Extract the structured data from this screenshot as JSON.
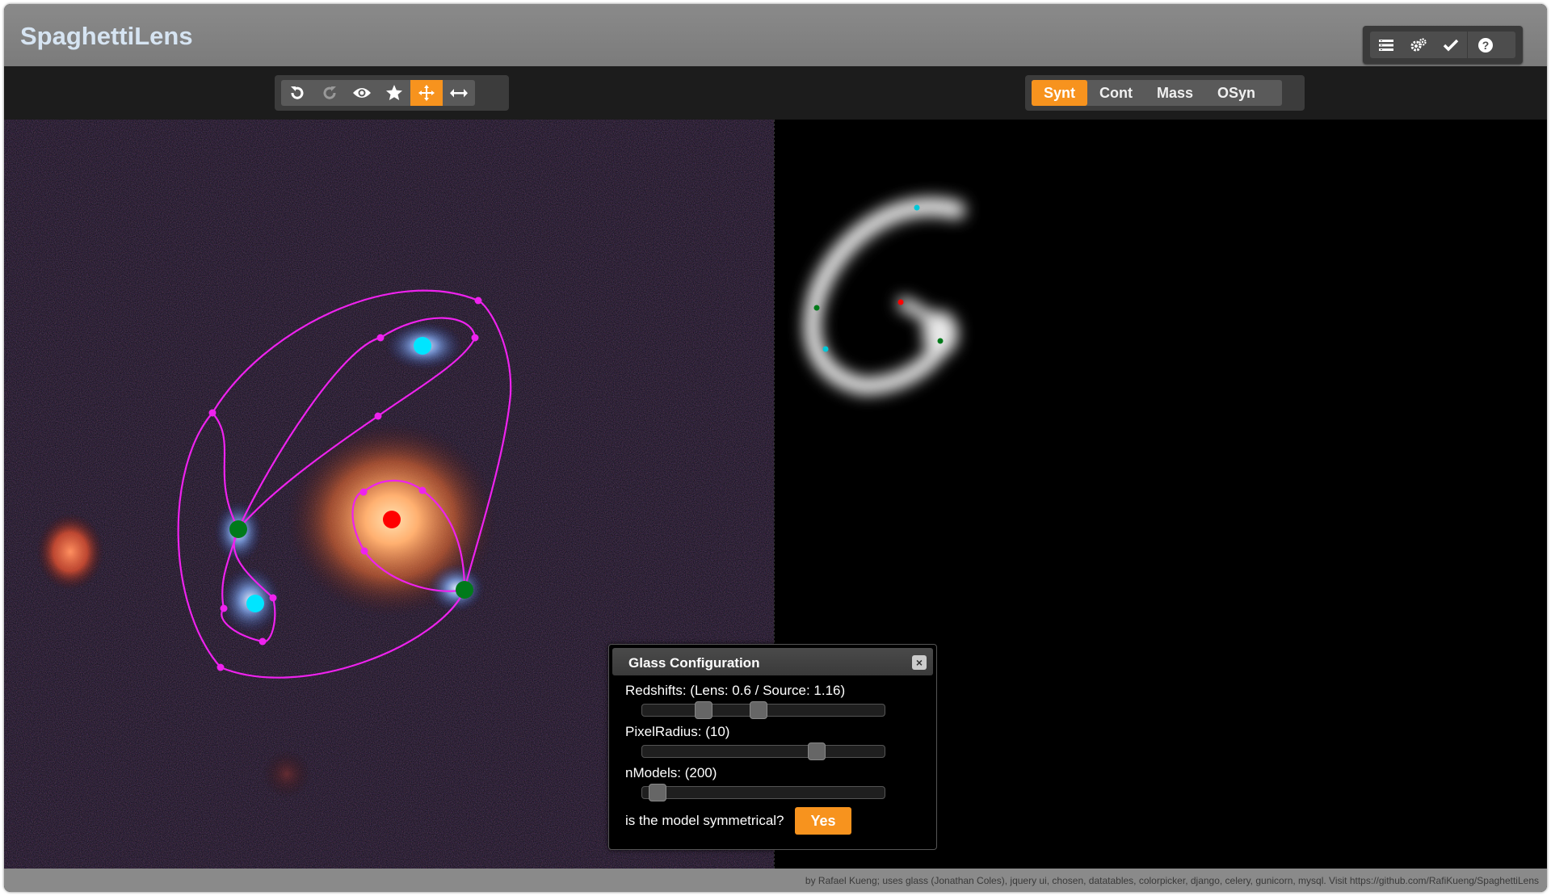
{
  "app": {
    "title": "SpaghettiLens"
  },
  "top_right_buttons": [
    {
      "icon": "list-icon"
    },
    {
      "icon": "gears-icon"
    },
    {
      "icon": "check-icon"
    },
    {
      "icon": "help-icon"
    }
  ],
  "toolbar": {
    "tools": [
      {
        "icon": "undo-icon",
        "state": "enabled"
      },
      {
        "icon": "redo-icon",
        "state": "disabled"
      },
      {
        "icon": "eye-icon",
        "state": "enabled"
      },
      {
        "icon": "star-icon",
        "state": "enabled"
      },
      {
        "icon": "move-icon",
        "state": "active"
      },
      {
        "icon": "resize-horizontal-icon",
        "state": "enabled"
      }
    ],
    "modes": [
      {
        "label": "Synt",
        "active": true
      },
      {
        "label": "Cont",
        "active": false
      },
      {
        "label": "Mass",
        "active": false
      },
      {
        "label": "OSyn",
        "active": false
      }
    ]
  },
  "dialog": {
    "title": "Glass Configuration",
    "close_label": "×",
    "redshifts_label": "Redshifts: (Lens: 0.6 / Source: 1.16)",
    "pixelradius_label": "PixelRadius: (10)",
    "nmodels_label": "nModels: (200)",
    "symmetric_question": "is the model symmetrical?",
    "symmetric_button": "Yes",
    "values": {
      "lens_redshift": 0.6,
      "source_redshift": 1.16,
      "pixel_radius": 10,
      "n_models": 200
    }
  },
  "colors": {
    "accent": "#f7931e",
    "contour": "#ee22ee",
    "saddle_point": "#007a1a",
    "min_point": "#00e5ff",
    "max_point": "#ff0000"
  },
  "footer": {
    "credits": "by Rafael Kueng; uses glass (Jonathan Coles), jquery ui, chosen, datatables, colorpicker, django, celery, gunicorn, mysql. Visit https://github.com/RafiKueng/SpaghettiLens"
  }
}
